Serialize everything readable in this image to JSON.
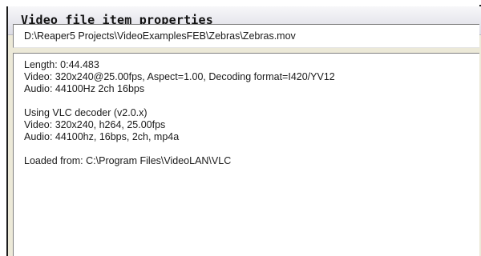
{
  "dialog": {
    "title": "Video file item properties",
    "file_path": "D:\\Reaper5 Projects\\VideoExamplesFEB\\Zebras\\Zebras.mov",
    "info": {
      "length": "Length: 0:44.483",
      "video": "Video: 320x240@25.00fps, Aspect=1.00, Decoding format=I420/YV12",
      "audio": "Audio: 44100Hz 2ch 16bps",
      "decoder": "Using VLC decoder (v2.0.x)",
      "decoder_video": "Video: 320x240, h264, 25.00fps",
      "decoder_audio": "Audio: 44100hz, 16bps, 2ch, mp4a",
      "loaded_from": "Loaded from: C:\\Program Files\\VideoLAN\\VLC"
    }
  }
}
